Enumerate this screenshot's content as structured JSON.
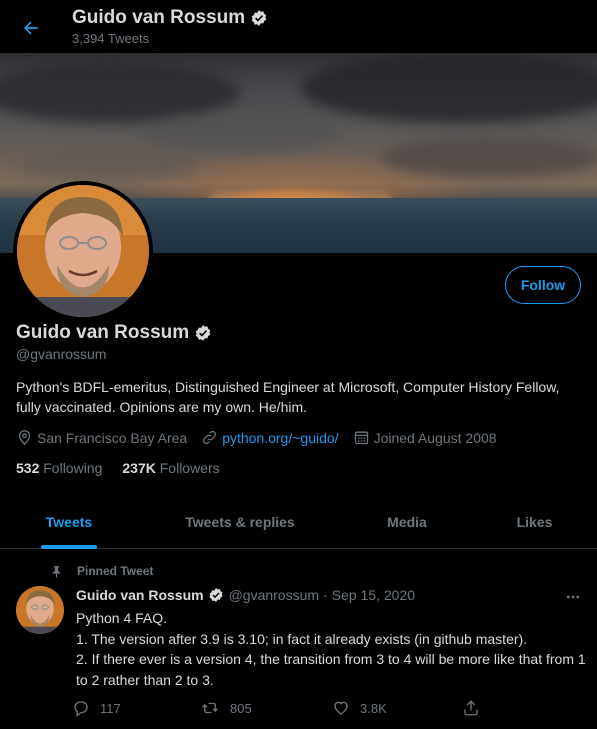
{
  "header": {
    "title": "Guido van Rossum",
    "tweet_count": "3,394 Tweets"
  },
  "profile": {
    "name": "Guido van Rossum",
    "handle": "@gvanrossum",
    "bio": "Python's BDFL-emeritus, Distinguished Engineer at Microsoft, Computer History Fellow, fully vaccinated. Opinions are my own. He/him.",
    "location": "San Francisco Bay Area",
    "website": "python.org/~guido/",
    "joined": "Joined August 2008",
    "following_count": "532",
    "following_label": "Following",
    "followers_count": "237K",
    "followers_label": "Followers",
    "follow_label": "Follow"
  },
  "tabs": [
    {
      "label": "Tweets",
      "active": true
    },
    {
      "label": "Tweets & replies",
      "active": false
    },
    {
      "label": "Media",
      "active": false
    },
    {
      "label": "Likes",
      "active": false
    }
  ],
  "pinned_tweet": {
    "pinned_label": "Pinned Tweet",
    "author_name": "Guido van Rossum",
    "author_handle": "@gvanrossum",
    "separator": "·",
    "date": "Sep 15, 2020",
    "lines": [
      "Python 4 FAQ.",
      "1. The version after 3.9 is 3.10; in fact it already exists (in github master).",
      "2. If there ever is a version 4, the transition from 3 to 4 will be more like that from 1 to 2 rather than 2 to 3."
    ],
    "replies": "117",
    "retweets": "805",
    "likes": "3.8K"
  },
  "colors": {
    "accent": "#1d9bf0",
    "background": "#000000",
    "text": "#d9d9d9",
    "muted": "#6e767d",
    "border": "#2f3336"
  },
  "icons": {
    "back": "arrow-left-icon",
    "verified": "verified-badge-icon",
    "location": "location-pin-icon",
    "link": "link-icon",
    "calendar": "calendar-icon",
    "pin": "pin-icon",
    "more": "more-dots-icon",
    "reply": "reply-icon",
    "retweet": "retweet-icon",
    "like": "heart-icon",
    "share": "share-icon"
  }
}
